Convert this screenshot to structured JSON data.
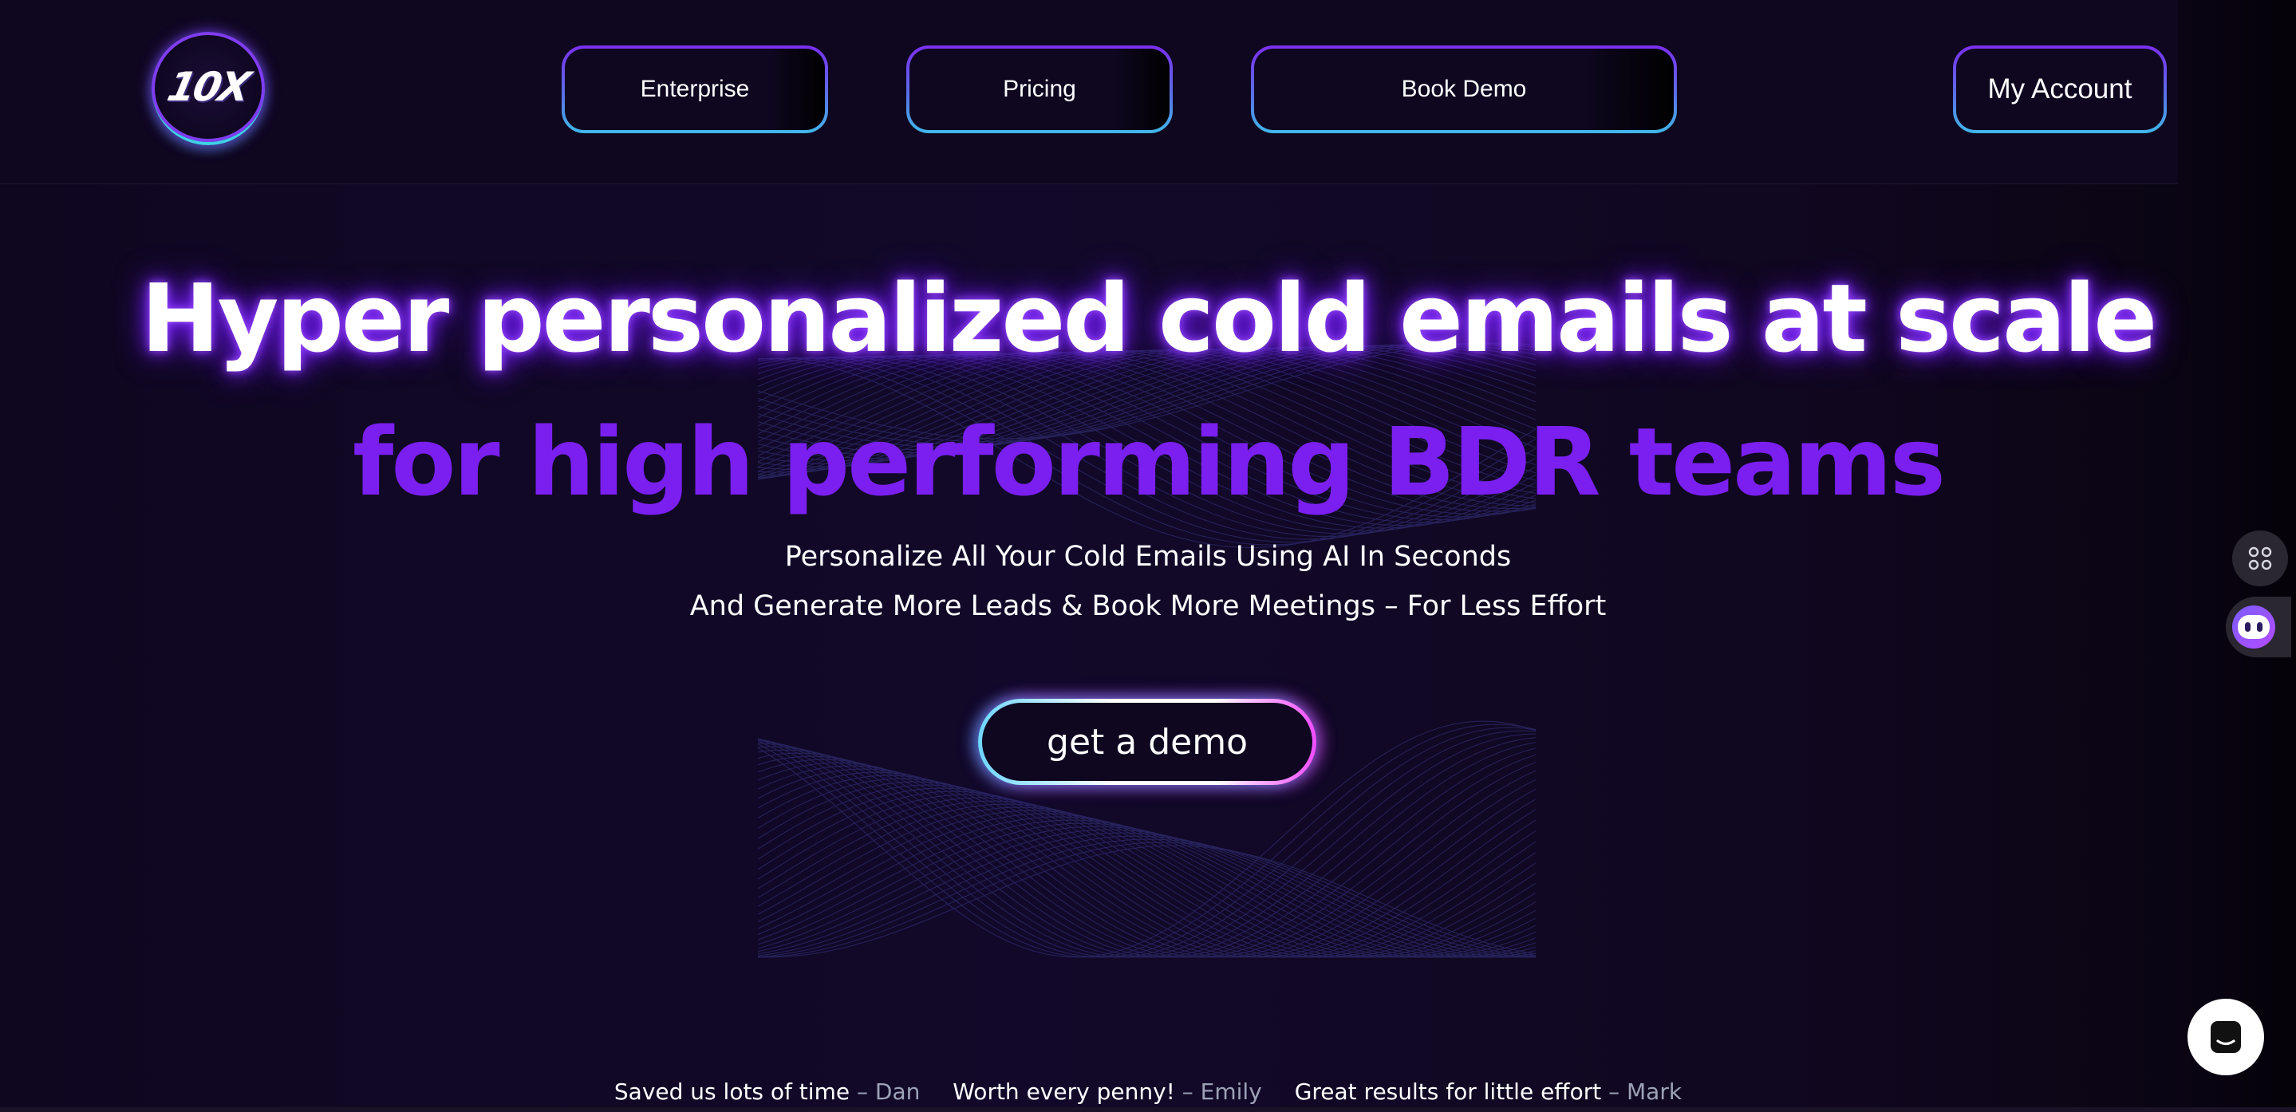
{
  "header": {
    "logo_text": "10X",
    "nav": {
      "enterprise": "Enterprise",
      "pricing": "Pricing",
      "book_demo": "Book Demo",
      "my_account": "My Account"
    }
  },
  "hero": {
    "title": "Hyper personalized cold emails at scale",
    "subtitle": "for high performing BDR teams",
    "tagline_1": "Personalize All Your Cold Emails Using AI In Seconds",
    "tagline_2": "And Generate More Leads & Book More Meetings – For Less Effort",
    "cta_label": "get a demo"
  },
  "testimonials": [
    {
      "quote": "Saved us lots of time",
      "author": "– Dan"
    },
    {
      "quote": "Worth every penny!",
      "author": "– Emily"
    },
    {
      "quote": "Great results for little effort",
      "author": "– Mark"
    }
  ],
  "widgets": {
    "apps_icon": "command-grid-icon",
    "assistant_icon": "ai-assistant-face-icon",
    "chat_icon": "chat-bubble-icon"
  },
  "colors": {
    "background": "#0f0720",
    "accent_purple": "#7a1ff0",
    "glow_purple": "#7a22ff",
    "border_cyan": "#41b8ea",
    "cta_magenta": "#f04cff"
  }
}
